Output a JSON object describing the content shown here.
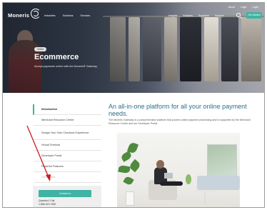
{
  "utility_nav": [
    "About",
    "Login",
    "Login"
  ],
  "brand": {
    "name": "Moneris"
  },
  "primary_nav": [
    "Industries",
    "Solutions",
    "Services"
  ],
  "secondary_nav": [
    "Insights",
    "Partners",
    "Suppliers",
    "Support"
  ],
  "header_cta": "Get Started",
  "hero": {
    "badge": "Online",
    "title": "Ecommerce",
    "subtitle": "Accept payments online with the Moneris® Gateway."
  },
  "sidenav": {
    "items": [
      {
        "label": "Introduction",
        "active": true
      },
      {
        "label": "Merchant Resource Center",
        "active": false
      },
      {
        "label": "Design Your Own Checkout Experience",
        "active": false
      },
      {
        "label": "Virtual Terminal",
        "active": false
      },
      {
        "label": "Developer Portal",
        "active": false
      },
      {
        "label": "Powerful Features",
        "active": false
      },
      {
        "label": "Get Started",
        "active": false
      }
    ],
    "box": {
      "button": "Contact us",
      "question": "Question? Call",
      "phone": "1-866-319-7450"
    }
  },
  "main": {
    "heading": "An all-in-one platform for all your online payment needs.",
    "paragraph": "The Moneris Gateway is a comprehensive platform that powers online payment processing and is supported by the Merchant Resource Center and our Developer Portal."
  },
  "colors": {
    "accent": "#3fb3a4",
    "heading": "#2f6e8a",
    "annotation": "#d01a1a"
  }
}
